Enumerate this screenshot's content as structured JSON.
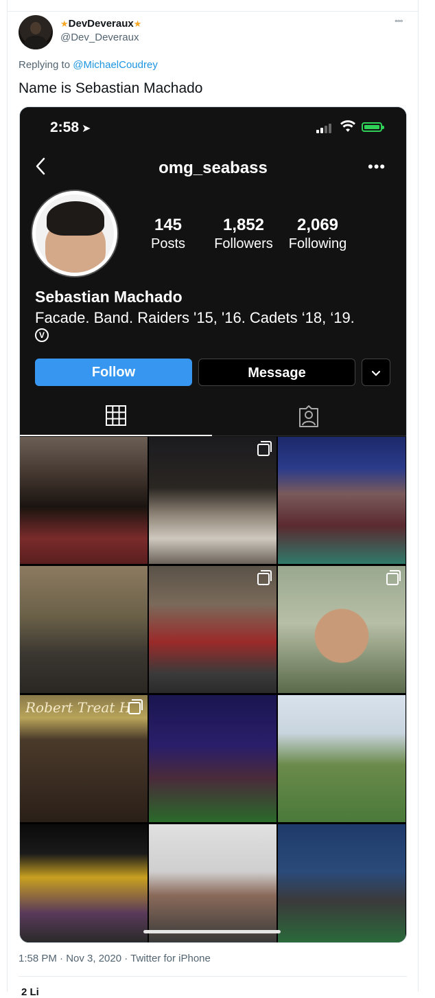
{
  "tweet": {
    "display_name": "DevDeveraux",
    "handle": "@Dev_Deveraux",
    "replying_prefix": "Replying to",
    "replying_to": "@MichaelCoudrey",
    "text": "Name is Sebastian Machado",
    "timestamp": "1:58 PM · Nov 3, 2020 · Twitter for iPhone",
    "likes_partial": "2 Li",
    "more_glyph": "°°°",
    "star_glyph": "★"
  },
  "phone": {
    "time": "2:58",
    "location_glyph": "➤",
    "battery_color": "#30d158"
  },
  "instagram": {
    "username": "omg_seabass",
    "more_glyph": "•••",
    "stats": [
      {
        "value": "145",
        "label": "Posts"
      },
      {
        "value": "1,852",
        "label": "Followers"
      },
      {
        "value": "2,069",
        "label": "Following"
      }
    ],
    "full_name": "Sebastian Machado",
    "bio": "Facade. Band. Raiders '15, '16. Cadets ‘18, ‘19.",
    "bio_badge": "V",
    "follow_label": "Follow",
    "message_label": "Message",
    "follow_color": "#3797f0",
    "photo_captions": {
      "hotel_sign": "Robert Treat H"
    },
    "grid_tile_count": 12
  }
}
